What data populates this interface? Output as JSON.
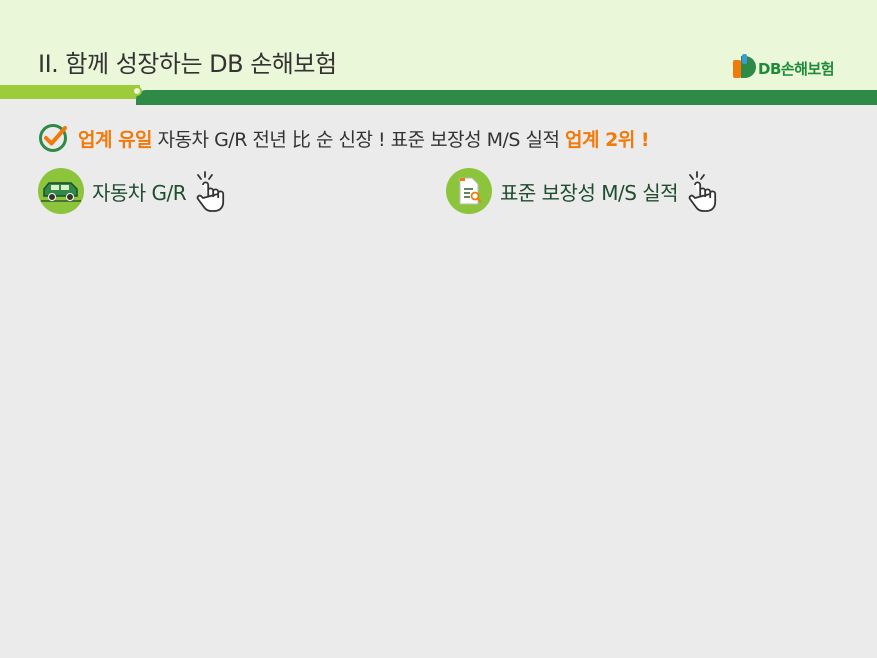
{
  "header": {
    "title": "II. 함께 성장하는 DB 손해보험",
    "logo_text": "DB손해보험"
  },
  "headline": {
    "part1": "업계 유일",
    "part2": " 자동차 G/R 전년 比 순 신장 ! 표준 보장성 M/S 실적 ",
    "part3": "업계 2위 !"
  },
  "links": [
    {
      "label": "자동차 G/R",
      "icon": "car-icon"
    },
    {
      "label": "표준 보장성 M/S 실적",
      "icon": "document-search-icon"
    }
  ],
  "colors": {
    "header_bg": "#eaf7d8",
    "accent_green": "#2e8a46",
    "light_green": "#9ccc3c",
    "highlight_orange": "#f07a0a",
    "background": "#ebebeb"
  }
}
